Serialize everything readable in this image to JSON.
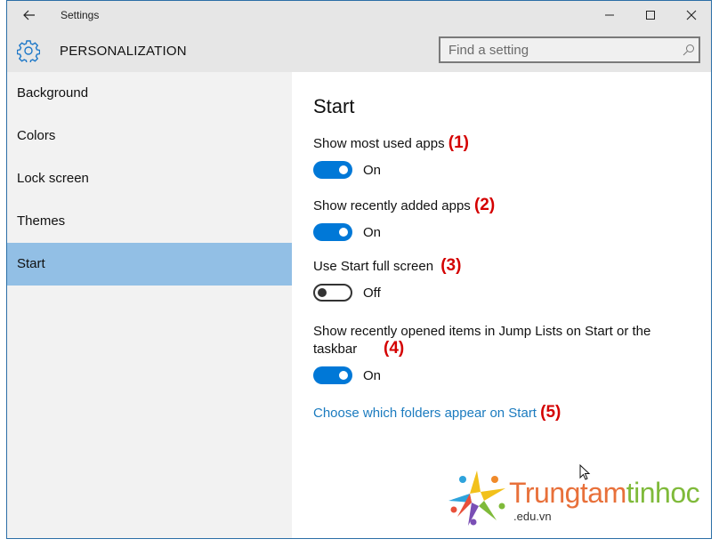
{
  "window": {
    "app_title": "Settings",
    "controls": {
      "minimize": "minimize-icon",
      "maximize": "maximize-icon",
      "close": "close-icon"
    }
  },
  "header": {
    "section_title": "PERSONALIZATION",
    "section_icon": "gear-icon",
    "search": {
      "placeholder": "Find a setting",
      "value": "",
      "icon": "search-icon"
    }
  },
  "sidebar": {
    "items": [
      {
        "label": "Background",
        "active": false
      },
      {
        "label": "Colors",
        "active": false
      },
      {
        "label": "Lock screen",
        "active": false
      },
      {
        "label": "Themes",
        "active": false
      },
      {
        "label": "Start",
        "active": true
      }
    ]
  },
  "main": {
    "title": "Start",
    "settings": [
      {
        "label": "Show most used apps",
        "annotation": "(1)",
        "state": "On",
        "on": true
      },
      {
        "label": "Show recently added apps",
        "annotation": "(2)",
        "state": "On",
        "on": true
      },
      {
        "label": "Use Start full screen",
        "annotation": "(3)",
        "state": "Off",
        "on": false
      },
      {
        "label": "Show recently opened items in Jump Lists on Start or the taskbar",
        "annotation": "(4)",
        "state": "On",
        "on": true
      }
    ],
    "link": {
      "label": "Choose which folders appear on Start",
      "annotation": "(5)"
    }
  },
  "watermark": {
    "part1": "Trungtam",
    "part2": "tinhoc",
    "sub": ".edu.vn"
  },
  "colors": {
    "accent": "#0078d7",
    "selected_nav": "#92bfe5",
    "link": "#1b7bbf",
    "annotation": "#d40000"
  }
}
